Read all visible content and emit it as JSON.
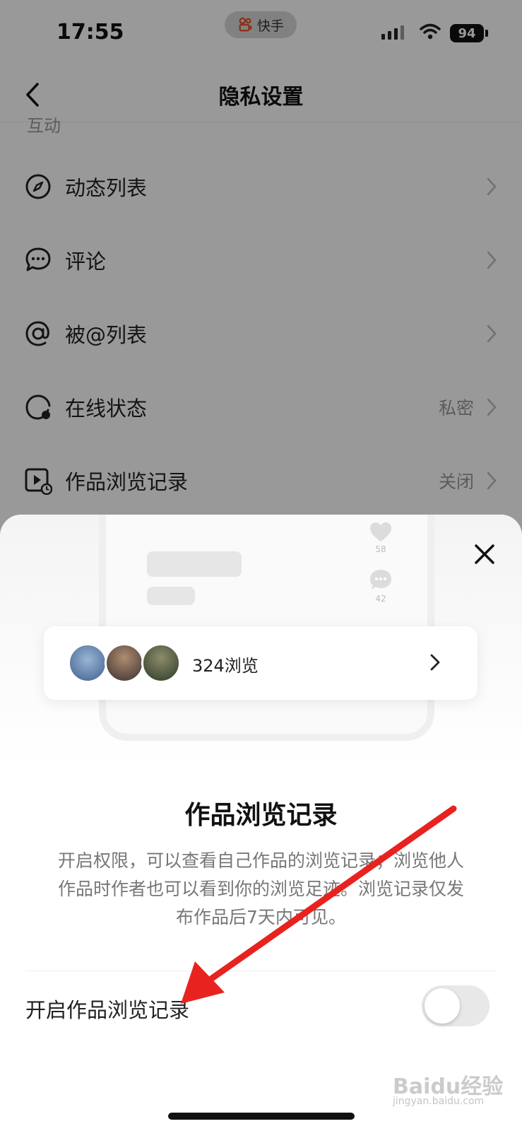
{
  "status_bar": {
    "time": "17:55",
    "app_name": "快手",
    "battery": "94"
  },
  "nav": {
    "title": "隐私设置"
  },
  "section": {
    "label": "互动"
  },
  "settings": [
    {
      "label": "动态列表",
      "value": "",
      "icon": "compass-icon"
    },
    {
      "label": "评论",
      "value": "",
      "icon": "comment-icon"
    },
    {
      "label": "被@列表",
      "value": "",
      "icon": "at-icon"
    },
    {
      "label": "在线状态",
      "value": "私密",
      "icon": "online-status-icon"
    },
    {
      "label": "作品浏览记录",
      "value": "关闭",
      "icon": "video-history-icon"
    }
  ],
  "sheet": {
    "preview": {
      "like_count": "58",
      "comment_count": "42"
    },
    "viewer_text": "324浏览",
    "title": "作品浏览记录",
    "description": "开启权限，可以查看自己作品的浏览记录；浏览他人作品时作者也可以看到你的浏览足迹。浏览记录仅发布作品后7天内可见。",
    "toggle_label": "开启作品浏览记录",
    "toggle_on": false
  },
  "watermark": {
    "main": "Baidu经验",
    "sub": "jingyan.baidu.com"
  },
  "colors": {
    "annotation_arrow": "#e8231f",
    "overlay": "rgba(0,0,0,0.4)"
  }
}
